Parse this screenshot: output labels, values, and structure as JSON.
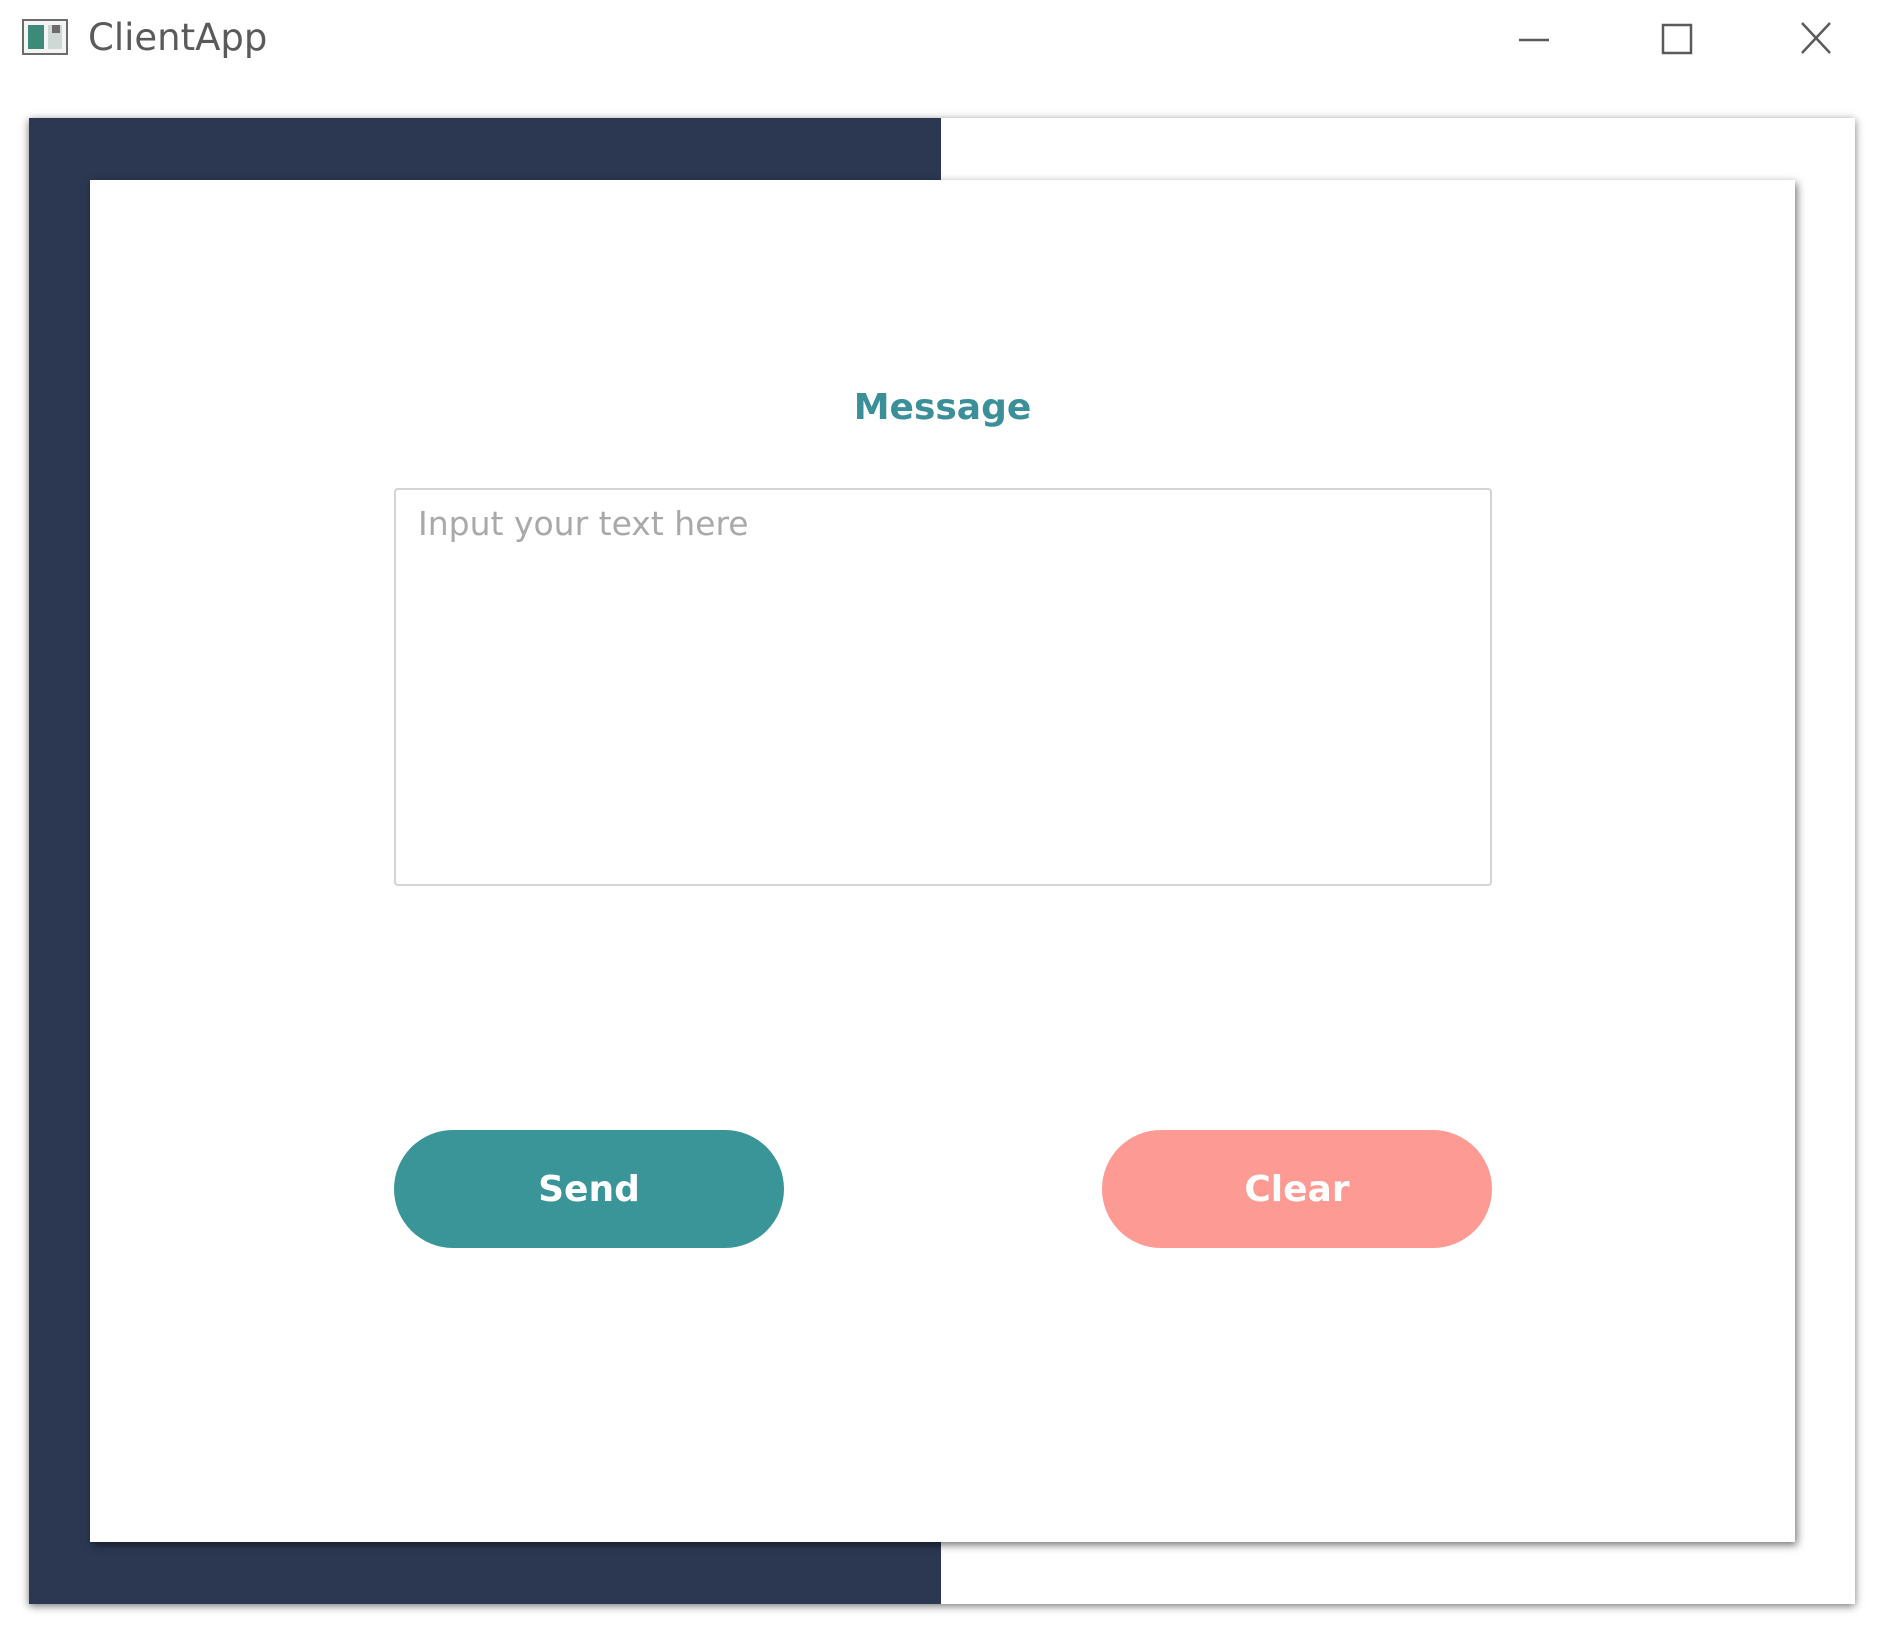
{
  "window": {
    "title": "ClientApp",
    "icon": "app-window-icon",
    "controls": {
      "minimize_icon": "minimize-icon",
      "maximize_icon": "maximize-icon",
      "close_icon": "close-icon"
    }
  },
  "form": {
    "label": "Message",
    "input": {
      "placeholder": "Input your text here",
      "value": ""
    },
    "send_label": "Send",
    "clear_label": "Clear"
  },
  "colors": {
    "sidebar_dark": "#2c3852",
    "accent_teal": "#3a9599",
    "label_teal": "#3a8f99",
    "clear_salmon": "#fd9a93"
  }
}
